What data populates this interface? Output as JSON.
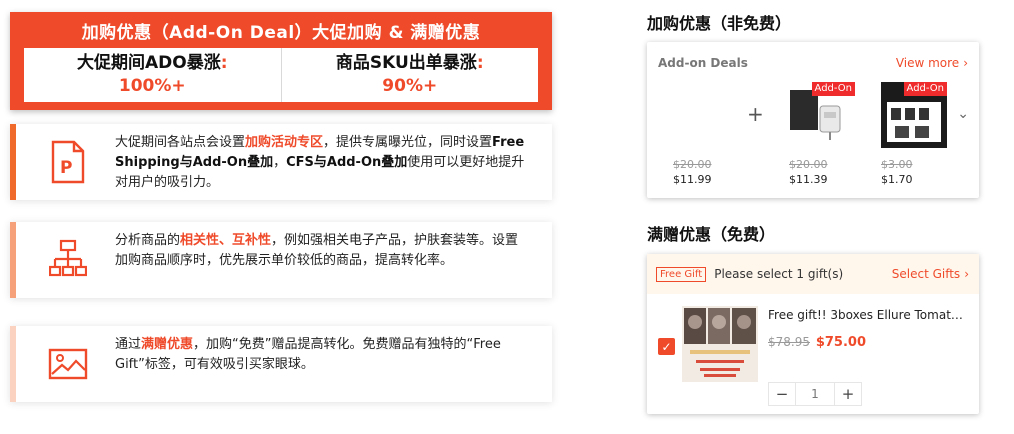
{
  "banner": {
    "title": "加购优惠（Add-On Deal）大促加购 & 满赠优惠",
    "stats": [
      {
        "label": "大促期间ADO暴涨",
        "value": "100%+"
      },
      {
        "label": "商品SKU出单暴涨",
        "value": "90%+"
      }
    ]
  },
  "cards": [
    {
      "icon": "ppt-file-icon",
      "accent": "#ef6a2b",
      "p1": "大促期间各站点会设置",
      "p2": "加购活动专区",
      "p3": "，提供专属曝光位，同时设置",
      "p4": "Free Shipping与Add-On叠加",
      "p5": "，",
      "p6": "CFS与Add-On叠加",
      "p7": "使用可以更好地提升对用户的吸引力。"
    },
    {
      "icon": "hierarchy-icon",
      "accent": "#f6a17a",
      "p1": "分析商品的",
      "p2": "相关性、互补性",
      "p3": "，例如强相关电子产品，护肤套装等。设置加购商品顺序时，优先展示单价较低的商品，提高转化率。"
    },
    {
      "icon": "image-icon",
      "accent": "#fbd2bf",
      "p1": "通过",
      "p2": "满赠优惠",
      "p3": "，加购“免费”赠品提高转化。免费赠品有独特的“Free Gift”标签，可有效吸引买家眼球。"
    }
  ],
  "addon_section": {
    "title": "加购优惠（非免费）",
    "header_label": "Add-on Deals",
    "view_more": "View more",
    "plus": "+",
    "products": [
      {
        "old": "$20.00",
        "new": "$11.99",
        "tag": ""
      },
      {
        "old": "$20.00",
        "new": "$11.39",
        "tag": "Add-On"
      },
      {
        "old": "$3.00",
        "new": "$1.70",
        "tag": "Add-On"
      }
    ]
  },
  "gift_section": {
    "title": "满赠优惠（免费）",
    "tag": "Free Gift",
    "prompt": "Please select 1 gift(s)",
    "select": "Select Gifts",
    "item_name": "Free gift!! 3boxes Ellure Tomato...",
    "old_price": "$78.95",
    "new_price": "$75.00",
    "qty": "1",
    "minus": "−",
    "plus": "+"
  },
  "colors": {
    "brand": "#ef4b2b",
    "muted": "#999999"
  }
}
